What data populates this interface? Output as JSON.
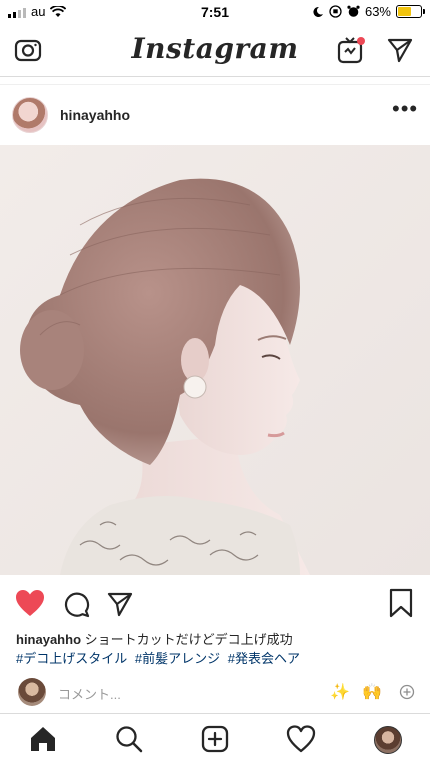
{
  "status_bar": {
    "carrier": "au",
    "time": "7:51",
    "battery_percent": "63%",
    "battery_level": 0.63,
    "battery_color": "#f1c40f"
  },
  "header": {
    "logo": "Instagram",
    "icons": [
      "camera-icon",
      "igtv-icon",
      "direct-message-icon"
    ],
    "notification_dot_color": "#ed4956"
  },
  "post": {
    "username": "hinayahho",
    "more": "•••",
    "liked": true,
    "like_color": "#ed4956",
    "caption_user": "hinayahho",
    "caption_text": "ショートカットだけどデコ上げ成功",
    "hashtags": [
      "#デコ上げスタイル",
      "#前髪アレンジ",
      "#発表会ヘア"
    ],
    "comment_placeholder": "コメント...",
    "quick_emojis": [
      "✨",
      "🙌"
    ]
  },
  "bottom_nav": {
    "items": [
      "home-icon",
      "search-icon",
      "new-post-icon",
      "activity-icon",
      "profile-avatar"
    ]
  },
  "colors": {
    "hashtag": "#003569",
    "border": "#dbdbdb",
    "text": "#262626"
  }
}
